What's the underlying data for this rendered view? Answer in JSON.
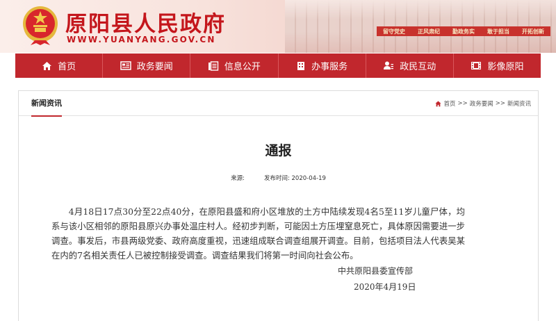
{
  "header": {
    "site_title": "原阳县人民政府",
    "site_url": "WWW.YUANYANG.GOV.CN",
    "slogan_strip": [
      "留守党史",
      "正风肃纪",
      "勤政务实",
      "敢于担当",
      "开拓创新"
    ]
  },
  "nav": {
    "items": [
      {
        "label": "首页",
        "icon": "home-icon"
      },
      {
        "label": "政务要闻",
        "icon": "newspaper-icon"
      },
      {
        "label": "信息公开",
        "icon": "document-icon"
      },
      {
        "label": "办事服务",
        "icon": "building-icon"
      },
      {
        "label": "政民互动",
        "icon": "user-chat-icon"
      },
      {
        "label": "影像原阳",
        "icon": "film-icon"
      }
    ]
  },
  "panel": {
    "tab_label": "新闻资讯",
    "breadcrumb": [
      "首页",
      ">>",
      "政务要闻",
      ">>",
      "新闻资讯"
    ]
  },
  "article": {
    "title": "通报",
    "source_label": "来源:",
    "source_value": "",
    "date_label": "发布时间:",
    "date_value": "2020-04-19",
    "body": "4月18日17点30分至22点40分，在原阳县盛和府小区堆放的土方中陆续发现4名5至11岁儿童尸体，均系与该小区相邻的原阳县原兴办事处温庄村人。经初步判断，可能因土方压埋窒息死亡，具体原因需要进一步调查。事发后，市县两级党委、政府高度重视，迅速组成联合调查组展开调查。目前，包括项目法人代表吴某在内的7名相关责任人已被控制接受调查。调查结果我们将第一时间向社会公布。",
    "signature_org": "中共原阳县委宣传部",
    "signature_date": "2020年4月19日"
  },
  "colors": {
    "brand_red": "#c1272d",
    "title_red": "#c4161c"
  }
}
